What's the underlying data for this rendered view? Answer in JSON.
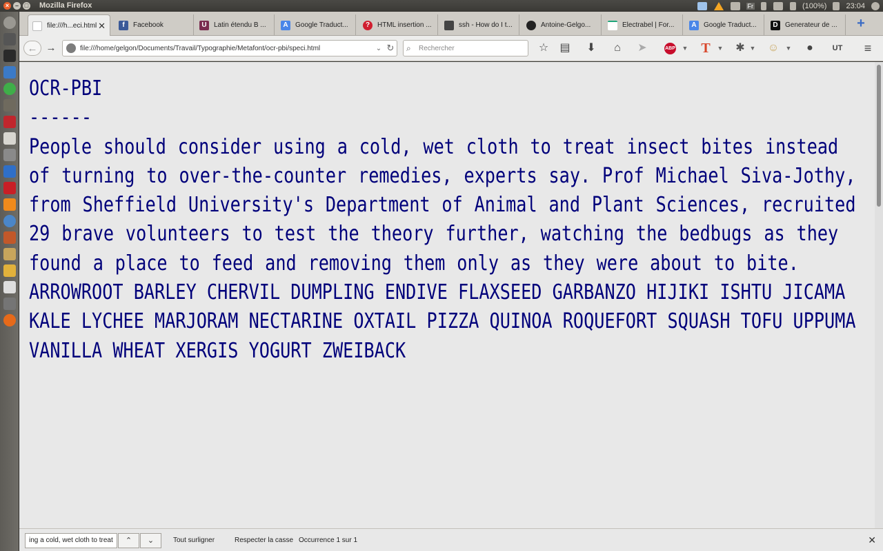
{
  "system": {
    "window_title": "Mozilla Firefox",
    "battery": "(100%)",
    "time": "23:04",
    "keyboard": "Fr"
  },
  "tabs": [
    {
      "label": "file:///h...eci.html",
      "icon": "page-icon",
      "active": true
    },
    {
      "label": "Facebook",
      "icon": "facebook-icon"
    },
    {
      "label": "Latin étendu B ...",
      "icon": "unicode-icon"
    },
    {
      "label": "Google Traduct...",
      "icon": "google-translate-icon"
    },
    {
      "label": "HTML insertion ...",
      "icon": "quora-icon"
    },
    {
      "label": "ssh - How do I t...",
      "icon": "stackexchange-icon"
    },
    {
      "label": "Antoine-Gelgo...",
      "icon": "github-icon"
    },
    {
      "label": "Electrabel | For...",
      "icon": "electrabel-icon"
    },
    {
      "label": "Google Traduct...",
      "icon": "google-translate-icon"
    },
    {
      "label": "Generateur de ...",
      "icon": "dcode-icon"
    }
  ],
  "navbar": {
    "url": "file:///home/gelgon/Documents/Travail/Typographie/Metafont/ocr-pbi/speci.html",
    "search_placeholder": "Rechercher",
    "abp_label": "ABP",
    "t_label": "T",
    "ut_label": "UT"
  },
  "document": {
    "title": "OCR-PBI",
    "underline": "------",
    "paragraph": "People should consider using a cold, wet cloth to treat insect bites instead of turning to over-the-counter remedies, experts say. Prof Michael Siva-Jothy, from Sheffield University's Department of Animal and Plant Sciences, recruited 29 brave volunteers to test the theory further, watching the bedbugs as they found a place to feed and removing them only as they were about to bite.",
    "words_line1": "ARROWROOT BARLEY CHERVIL DUMPLING ENDIVE FLAXSEED GARBANZO HIJIKI ISHTU JICAMA",
    "words_line2": "KALE LYCHEE MARJORAM NECTARINE OXTAIL PIZZA QUINOA ROQUEFORT SQUASH TOFU UPPUMA",
    "words_line3": "VANILLA WHEAT XERGIS YOGURT ZWEIBACK"
  },
  "findbar": {
    "query": "ing a cold, wet cloth to treat",
    "highlight_all": "Tout surligner",
    "match_case": "Respecter la casse",
    "status": "Occurrence 1 sur 1"
  },
  "colors": {
    "text": "#00007a",
    "background": "#e8e8e8"
  }
}
